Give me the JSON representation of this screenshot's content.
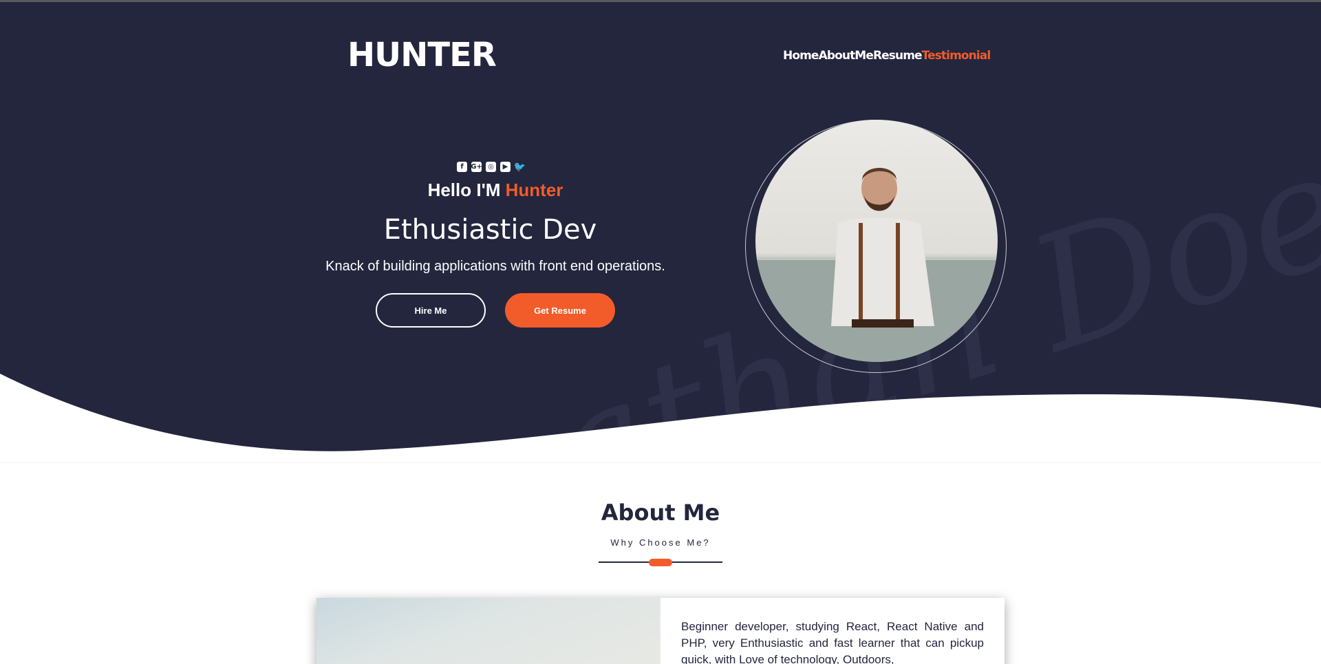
{
  "header": {
    "logo": "HUNTER",
    "nav": [
      {
        "label": "Home"
      },
      {
        "label": "AboutMe"
      },
      {
        "label": "Resume"
      },
      {
        "label": "Testimonial"
      }
    ]
  },
  "hero": {
    "socials": [
      "facebook-icon",
      "google-plus-icon",
      "instagram-icon",
      "youtube-icon",
      "twitter-icon"
    ],
    "hello_prefix": "Hello I'M ",
    "hello_name": "Hunter",
    "role": "Ethusiastic Dev",
    "tagline": "Knack of building applications with front end operations.",
    "hire_label": "Hire Me",
    "resume_label": "Get Resume",
    "watermark": "Jonathan Doe"
  },
  "about": {
    "title": "About Me",
    "subtitle": "Why Choose Me?",
    "description": "Beginner developer, studying React, React Native and PHP, very Enthusiastic and fast learner that can pickup quick, with Love of technology, Outdoors,"
  },
  "colors": {
    "hero_bg": "#23263d",
    "accent": "#f25c2a",
    "text_light": "#ffffff",
    "text_dark": "#23263d"
  }
}
